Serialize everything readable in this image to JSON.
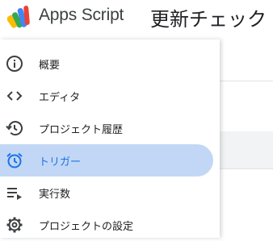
{
  "header": {
    "app_name": "Apps Script",
    "project_title": "更新チェック"
  },
  "sidebar": {
    "items": [
      {
        "label": "概要",
        "icon": "info-icon",
        "selected": false
      },
      {
        "label": "エディタ",
        "icon": "code-icon",
        "selected": false
      },
      {
        "label": "プロジェクト履歴",
        "icon": "history-icon",
        "selected": false
      },
      {
        "label": "トリガー",
        "icon": "alarm-clock-icon",
        "selected": true
      },
      {
        "label": "実行数",
        "icon": "executions-list-icon",
        "selected": false
      },
      {
        "label": "プロジェクトの設定",
        "icon": "gear-icon",
        "selected": false
      }
    ]
  },
  "colors": {
    "selected_background": "#c2d7f5",
    "selected_accent": "#1a73e8",
    "icon_default": "#3c4043"
  }
}
